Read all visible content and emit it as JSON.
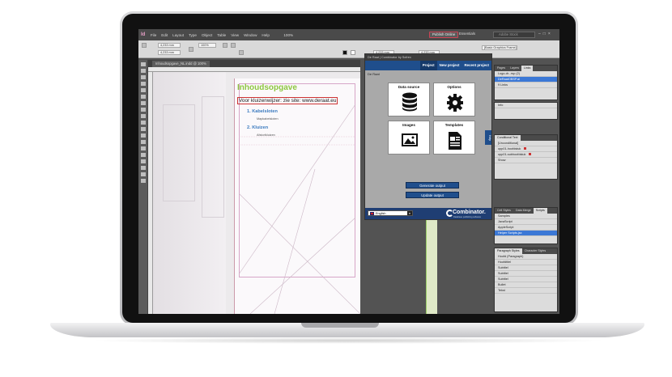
{
  "menubar": {
    "app_logo": "Id",
    "items": [
      "File",
      "Edit",
      "Layout",
      "Type",
      "Object",
      "Table",
      "View",
      "Window",
      "Help"
    ],
    "zoom": "100%",
    "publish_button": "Publish Online",
    "workspace": "Essentials",
    "search_placeholder": "Adobe Stock",
    "window_controls": [
      "–",
      "□",
      "×"
    ]
  },
  "controlbar": {
    "x_field": "4,233 mm",
    "y_field": "4,233 mm",
    "w_field": "4,233 mm",
    "frame_style": "[Basic Graphics Frame]",
    "percent_field": "100%"
  },
  "document": {
    "tab_label": "Inhoudsopgave_NL.indd @ 100%",
    "title": "Inhoudsopgave",
    "subtitle": "Voor kluizenwijzer: zie site: www.deraat.eu",
    "toc": [
      {
        "num": "1.",
        "heading": "Kabelsloten",
        "sub": "Mapkabelsloten"
      },
      {
        "num": "2.",
        "heading": "Kluizen",
        "sub": "Afstortkluizen"
      }
    ]
  },
  "plugin": {
    "titlebar": "De Raat  |  Combinator by Sofrex",
    "tabs": [
      "Project",
      "New project",
      "Recent project"
    ],
    "user": "De Raat",
    "tiles": [
      {
        "label": "Data source",
        "icon": "database-icon"
      },
      {
        "label": "Options",
        "icon": "gear-icon"
      },
      {
        "label": "Images",
        "icon": "image-icon"
      },
      {
        "label": "Templates",
        "icon": "template-icon"
      }
    ],
    "generate_button": "Generate output",
    "update_button": "Update output",
    "help_tab": "Help",
    "language": "English",
    "brand": "Combinator.",
    "brand_sub": "Database publishing software"
  },
  "panels": {
    "top": {
      "tabs": [
        "Pages",
        "Layers",
        "Links"
      ],
      "rows": [
        "Logo-dr...rsp (2)",
        "DeRaatOBSP.ai",
        "9 Links"
      ]
    },
    "info": {
      "rows": [
        "Info"
      ]
    },
    "conditional": {
      "tabs": [
        "Conditional Text"
      ],
      "rows": [
        "[Unconditional]",
        "opp01-hoofdstuk",
        "opp01-subhoofdstuk"
      ],
      "visibility": "Show"
    },
    "scripts": {
      "tabs": [
        "Cell Styles",
        "Data Merge",
        "Scripts"
      ],
      "rows": [
        "Samples",
        "JavaScript",
        "AppleScript",
        "Helpers",
        "Helper Scripts.jsx"
      ]
    },
    "styles": {
      "tabs": [
        "Paragraph Styles",
        "Character Styles"
      ],
      "rows": [
        "Hoofd (Paragraph)",
        "Hoofdtitel",
        "Subtitel",
        "Subtitel",
        "Subtitel",
        "Bullet",
        "Tekst"
      ]
    }
  }
}
